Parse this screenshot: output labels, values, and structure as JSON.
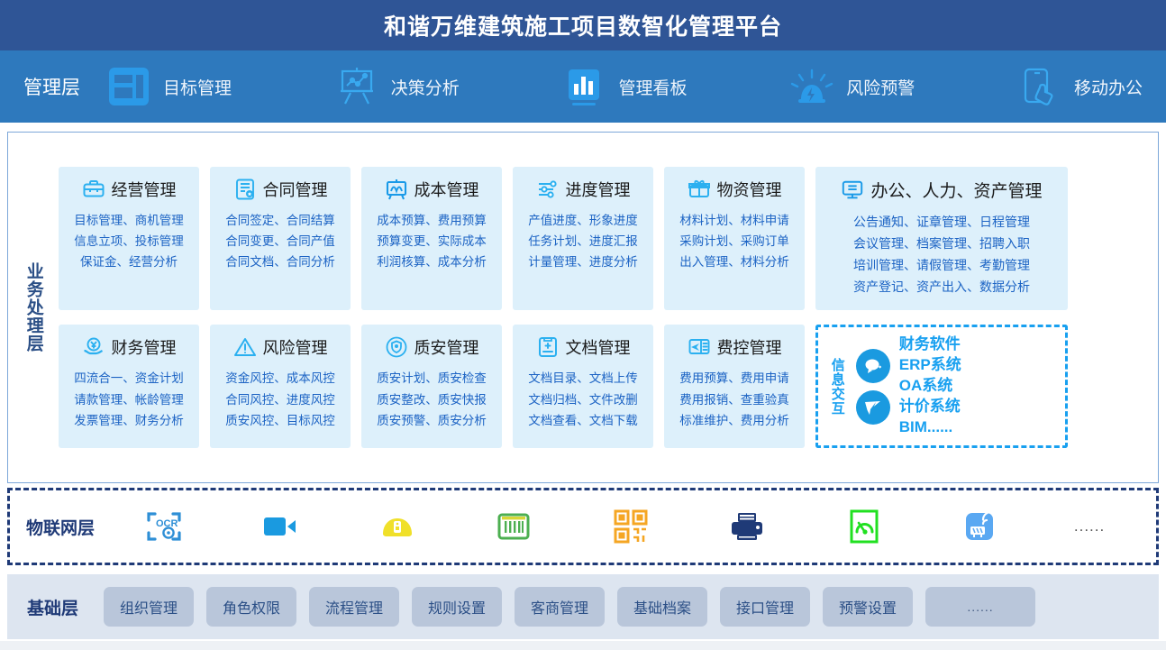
{
  "header": {
    "title": "和谐万维建筑施工项目数智化管理平台",
    "bg": "#2f5596"
  },
  "management_layer": {
    "label": "管理层",
    "bg": "#2e79bd",
    "items": [
      {
        "icon": "dashboard-layout-icon",
        "label": "目标管理"
      },
      {
        "icon": "easel-chart-icon",
        "label": "决策分析"
      },
      {
        "icon": "bar-chart-icon",
        "label": "管理看板"
      },
      {
        "icon": "alarm-light-icon",
        "label": "风险预警"
      },
      {
        "icon": "mobile-tap-icon",
        "label": "移动办公"
      }
    ]
  },
  "business_layer": {
    "side_label": "业务处理层",
    "card_bg": "#ddf0fb",
    "text_color": "#1c63c4",
    "row1": [
      {
        "icon": "briefcase-icon",
        "title": "经营管理",
        "lines": "目标管理、商机管理\n信息立项、投标管理\n保证金、经营分析"
      },
      {
        "icon": "contract-doc-icon",
        "title": "合同管理",
        "lines": "合同签定、合同结算\n合同变更、合同产值\n合同文档、合同分析"
      },
      {
        "icon": "cost-board-icon",
        "title": "成本管理",
        "lines": "成本预算、费用预算\n预算变更、实际成本\n利润核算、成本分析"
      },
      {
        "icon": "sliders-icon",
        "title": "进度管理",
        "lines": "产值进度、形象进度\n任务计划、进度汇报\n计量管理、进度分析"
      },
      {
        "icon": "material-box-icon",
        "title": "物资管理",
        "lines": "材料计划、材料申请\n采购计划、采购订单\n出入管理、材料分析"
      },
      {
        "icon": "monitor-icon",
        "title": "办公、人力、资产管理",
        "lines": "公告通知、证章管理、日程管理\n会议管理、档案管理、招聘入职\n培训管理、请假管理、考勤管理\n资产登记、资产出入、数据分析"
      }
    ],
    "row2": [
      {
        "icon": "finance-yuan-icon",
        "title": "财务管理",
        "lines": "四流合一、资金计划\n请款管理、帐龄管理\n发票管理、财务分析"
      },
      {
        "icon": "warning-triangle-icon",
        "title": "风险管理",
        "lines": "资金风控、成本风控\n合同风控、进度风控\n质安风控、目标风控"
      },
      {
        "icon": "shield-check-icon",
        "title": "质安管理",
        "lines": "质安计划、质安检查\n质安整改、质安快报\n质安预警、质安分析"
      },
      {
        "icon": "document-icon",
        "title": "文档管理",
        "lines": "文档目录、文档上传\n文档归档、文件改删\n文档查看、文档下载"
      },
      {
        "icon": "expense-ticket-icon",
        "title": "费控管理",
        "lines": "费用预算、费用申请\n费用报销、查重验真\n标准维护、费用分析"
      }
    ],
    "info_exchange": {
      "side_label": "信息交互",
      "border_color": "#18a0f0",
      "icons": [
        "chat-bubble-icon",
        "paper-plane-icon"
      ],
      "systems": "财务软件\nERP系统\nOA系统\n计价系统\nBIM......"
    }
  },
  "iot_layer": {
    "label": "物联网层",
    "border_color": "#1f3a77",
    "icons": [
      {
        "name": "ocr-scan-icon",
        "color": "#2e8fd6"
      },
      {
        "name": "video-camera-icon",
        "color": "#1a9ae0"
      },
      {
        "name": "safety-helmet-icon",
        "color": "#f0e02a"
      },
      {
        "name": "barcode-icon",
        "color": "#4caf50"
      },
      {
        "name": "qr-code-icon",
        "color": "#f5a623"
      },
      {
        "name": "printer-icon",
        "color": "#1f3a77"
      },
      {
        "name": "gauge-meter-icon",
        "color": "#21e021"
      },
      {
        "name": "wifi-router-icon",
        "color": "#5aa8f2"
      }
    ],
    "more": "......"
  },
  "base_layer": {
    "label": "基础层",
    "bg": "#dde5f0",
    "chip_bg": "#b9c6da",
    "items": [
      "组织管理",
      "角色权限",
      "流程管理",
      "规则设置",
      "客商管理",
      "基础档案",
      "接口管理",
      "预警设置"
    ],
    "more": "......"
  }
}
